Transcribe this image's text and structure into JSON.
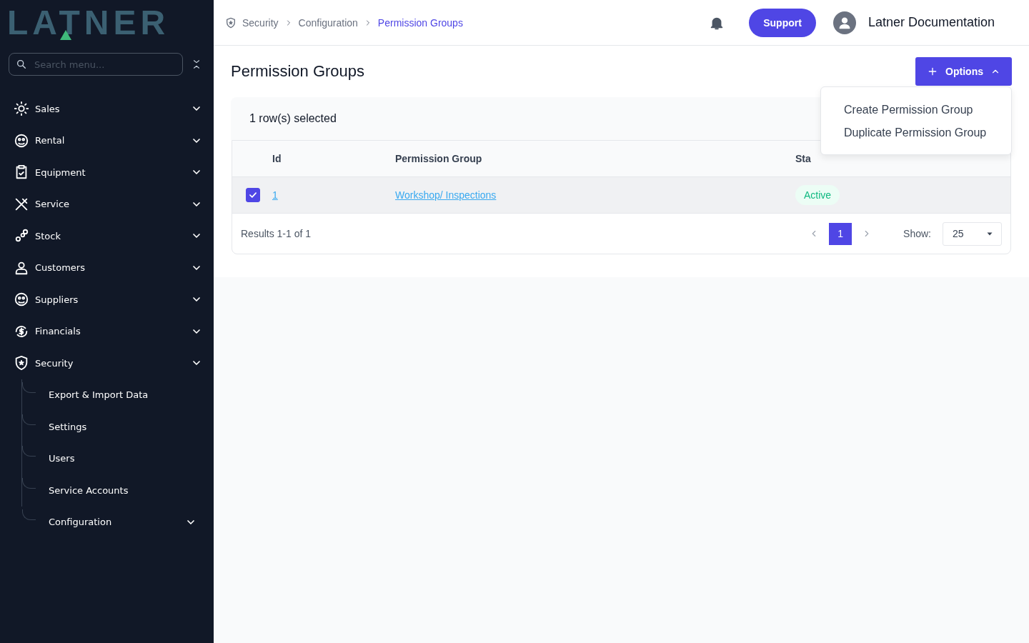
{
  "sidebar": {
    "logo": "LATNER",
    "search": {
      "placeholder": "Search menu..."
    },
    "items": [
      {
        "label": "Sales",
        "kind": "group"
      },
      {
        "label": "Rental",
        "kind": "group"
      },
      {
        "label": "Equipment",
        "kind": "group"
      },
      {
        "label": "Service",
        "kind": "group"
      },
      {
        "label": "Stock",
        "kind": "group"
      },
      {
        "label": "Customers",
        "kind": "group"
      },
      {
        "label": "Suppliers",
        "kind": "group"
      },
      {
        "label": "Financials",
        "kind": "group"
      },
      {
        "label": "Security",
        "kind": "group",
        "children": [
          {
            "label": "Export & Import Data",
            "kind": "link"
          },
          {
            "label": "Settings",
            "kind": "link"
          },
          {
            "label": "Users",
            "kind": "link"
          },
          {
            "label": "Service Accounts",
            "kind": "link"
          },
          {
            "label": "Configuration",
            "kind": "group"
          }
        ]
      }
    ]
  },
  "breadcrumbs": [
    {
      "label": "Security",
      "current": false
    },
    {
      "label": "Configuration",
      "current": false
    },
    {
      "label": "Permission Groups",
      "current": true
    }
  ],
  "header": {
    "support": "Support",
    "user": "Latner Documentation"
  },
  "page": {
    "title": "Permission Groups",
    "options": {
      "label": "Options",
      "open": true,
      "items": [
        "Create Permission Group",
        "Duplicate Permission Group"
      ]
    }
  },
  "table": {
    "selection": "1 row(s) selected",
    "columns": [
      "Id",
      "Permission Group",
      "Sta"
    ],
    "rows": [
      {
        "selected": true,
        "id": "1",
        "name": "Workshop/ Inspections",
        "status": "Active"
      }
    ]
  },
  "footer": {
    "results": "Results 1-1 of 1",
    "pages": [
      {
        "label": "1",
        "selected": true
      }
    ],
    "show_label": "Show:",
    "page_size": "25"
  }
}
